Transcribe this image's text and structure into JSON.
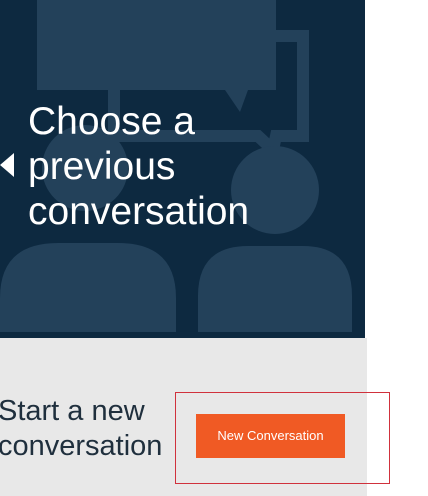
{
  "hero": {
    "title_line1": "Choose a",
    "title_line2": "previous",
    "title_line3": "conversation",
    "back_icon": "chevron-left-icon",
    "illustration": "conversation-people-illustration"
  },
  "start": {
    "line1": "Start a new",
    "line2": "conversation"
  },
  "new_conversation_button": {
    "label": "New Conversation"
  },
  "colors": {
    "hero_background": "#0d2940",
    "illustration_shape": "#23415a",
    "panel_background": "#e8e8e8",
    "button_background": "#f05a24",
    "highlight_border": "#d0313c"
  }
}
